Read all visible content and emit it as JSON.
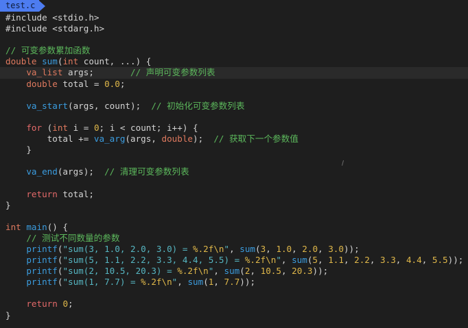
{
  "tab": {
    "filename": "test.c"
  },
  "colors": {
    "background": "#1e1e1e",
    "tab": "#4d7cf0",
    "type": "#e07a5f",
    "function": "#3b9de0",
    "number": "#e0b84a",
    "string": "#56b6c2",
    "keyword": "#e46a6a",
    "comment": "#5cb85c",
    "plain": "#d4d4d4"
  },
  "code": {
    "l1": [
      "#include <stdio.h>"
    ],
    "l2": [
      "#include <stdarg.h>"
    ],
    "l3": [],
    "l4": [
      "// 可变参数累加函数"
    ],
    "l5": [
      "double",
      " ",
      "sum",
      "(",
      "int",
      " count, ...) {"
    ],
    "l6": [
      "    ",
      "va_list",
      " args;       ",
      "// 声明可变参数列表"
    ],
    "l7": [
      "    ",
      "double",
      " total = ",
      "0.0",
      ";"
    ],
    "l8": [],
    "l9": [
      "    ",
      "va_start",
      "(args, count);  ",
      "// 初始化可变参数列表"
    ],
    "l10": [],
    "l11": [
      "    ",
      "for",
      " (",
      "int",
      " i = ",
      "0",
      "; i < count; i++) {"
    ],
    "l12": [
      "        total += ",
      "va_arg",
      "(args, ",
      "double",
      ");  ",
      "// 获取下一个参数值"
    ],
    "l13": [
      "    }"
    ],
    "l14": [],
    "l15": [
      "    ",
      "va_end",
      "(args);  ",
      "// 清理可变参数列表"
    ],
    "l16": [],
    "l17": [
      "    ",
      "return",
      " total;"
    ],
    "l18": [
      "}"
    ],
    "l19": [],
    "l20": [
      "int",
      " ",
      "main",
      "() {"
    ],
    "l21": [
      "    ",
      "// 测试不同数量的参数"
    ],
    "l22": [
      "    ",
      "printf",
      "(",
      "\"sum(3, 1.0, 2.0, 3.0) = ",
      "%.2f\\n",
      "\"",
      ", ",
      "sum",
      "(",
      "3",
      ", ",
      "1.0",
      ", ",
      "2.0",
      ", ",
      "3.0",
      "));"
    ],
    "l23": [
      "    ",
      "printf",
      "(",
      "\"sum(5, 1.1, 2.2, 3.3, 4.4, 5.5) = ",
      "%.2f\\n",
      "\"",
      ", ",
      "sum",
      "(",
      "5",
      ", ",
      "1.1",
      ", ",
      "2.2",
      ", ",
      "3.3",
      ", ",
      "4.4",
      ", ",
      "5.5",
      "));"
    ],
    "l24": [
      "    ",
      "printf",
      "(",
      "\"sum(2, 10.5, 20.3) = ",
      "%.2f\\n",
      "\"",
      ", ",
      "sum",
      "(",
      "2",
      ", ",
      "10.5",
      ", ",
      "20.3",
      "));"
    ],
    "l25": [
      "    ",
      "printf",
      "(",
      "\"sum(1, 7.7) = ",
      "%.2f\\n",
      "\"",
      ", ",
      "sum",
      "(",
      "1",
      ", ",
      "7.7",
      "));"
    ],
    "l26": [],
    "l27": [
      "    ",
      "return",
      " ",
      "0",
      ";"
    ],
    "l28": [
      "}"
    ]
  }
}
